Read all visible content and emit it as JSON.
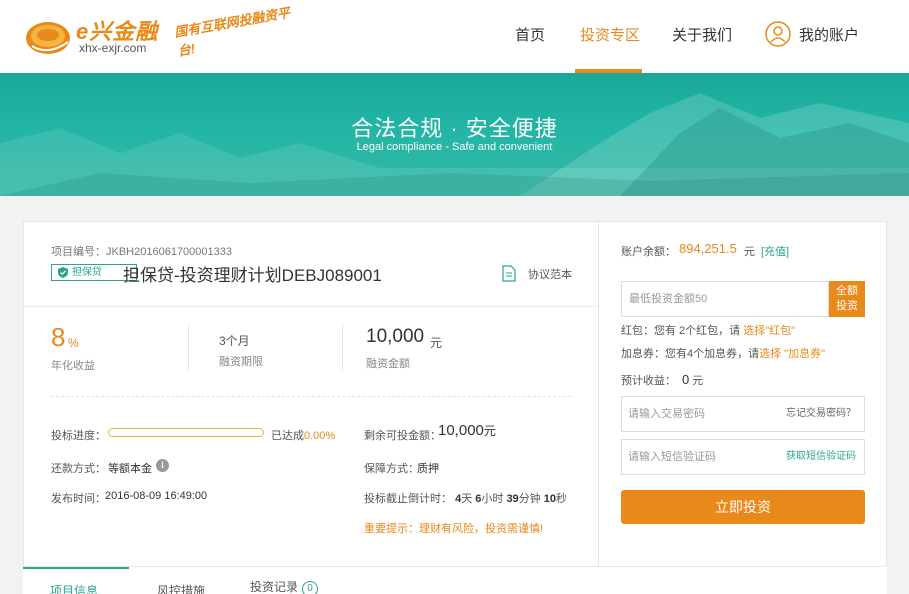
{
  "brand": {
    "name": "e兴金融",
    "domain": "xhx-exjr.com",
    "slogan": "国有互联网投融资平台!"
  },
  "nav": {
    "items": [
      {
        "label": "首页"
      },
      {
        "label": "投资专区"
      },
      {
        "label": "关于我们"
      },
      {
        "label": "我的账户"
      }
    ],
    "active": "投资专区"
  },
  "banner": {
    "title": "合法合规 · 安全便捷",
    "subtitle": "Legal compliance - Safe and convenient"
  },
  "project": {
    "number_label": "项目编号：JKBH2016061700001333",
    "tag": "担保贷",
    "title": "担保贷-投资理财计划DEBJ089001",
    "agreement_link": "协议范本",
    "rate": {
      "value": "8",
      "unit": "%",
      "label": "年化收益"
    },
    "term": {
      "value": "3个月",
      "label": "融资期限"
    },
    "amount": {
      "value": "10,000",
      "unit": "元",
      "label": "融资金额"
    },
    "progress": {
      "label": "投标进度：",
      "reached_prefix": "已达成",
      "reached_pct": "0.00%",
      "fraction": 0.0
    },
    "repay": {
      "label": "还款方式：",
      "value": "等额本金"
    },
    "publish": {
      "label": "发布时间：",
      "value": "2016-08-09 16:49:00"
    },
    "remaining": {
      "label": "剩余可投金额：",
      "value": "10,000",
      "unit": "元"
    },
    "guarantee": {
      "label": "保障方式：",
      "value": "质押"
    },
    "countdown": {
      "label": "投标截止倒计时：",
      "days": "4",
      "days_unit": "天",
      "hours": "6",
      "hours_unit": "小时",
      "minutes": "39",
      "minutes_unit": "分钟",
      "seconds": "10",
      "seconds_unit": "秒"
    },
    "notice": "重要提示：理财有风险，投资需谨慎!"
  },
  "tabs": [
    {
      "label": "项目信息"
    },
    {
      "label": "风控措施"
    },
    {
      "label": "投资记录",
      "badge": "0"
    }
  ],
  "invest": {
    "balance_label": "账户余额：",
    "balance": "894,251.5",
    "balance_unit": "元",
    "recharge": "[充值]",
    "amount_placeholder": "最低投资金额50",
    "allin_line1": "全额",
    "allin_line2": "投资",
    "redpacket": {
      "prefix": "红包：您有 2个红包，请 ",
      "link": "选择\"红包\""
    },
    "coupon": {
      "prefix": "加息券：您有4个加息券，请",
      "link": "选择 \"加息券\""
    },
    "expected_label": "预计收益：",
    "expected_value": "0",
    "expected_unit": "元",
    "password_placeholder": "请输入交易密码",
    "forgot_password": "忘记交易密码？",
    "sms_placeholder": "请输入短信验证码",
    "get_sms": "获取短信验证码",
    "submit": "立即投资"
  },
  "colors": {
    "accent": "#e8891a",
    "teal": "#2aa58e",
    "banner": "#1fae9f"
  }
}
